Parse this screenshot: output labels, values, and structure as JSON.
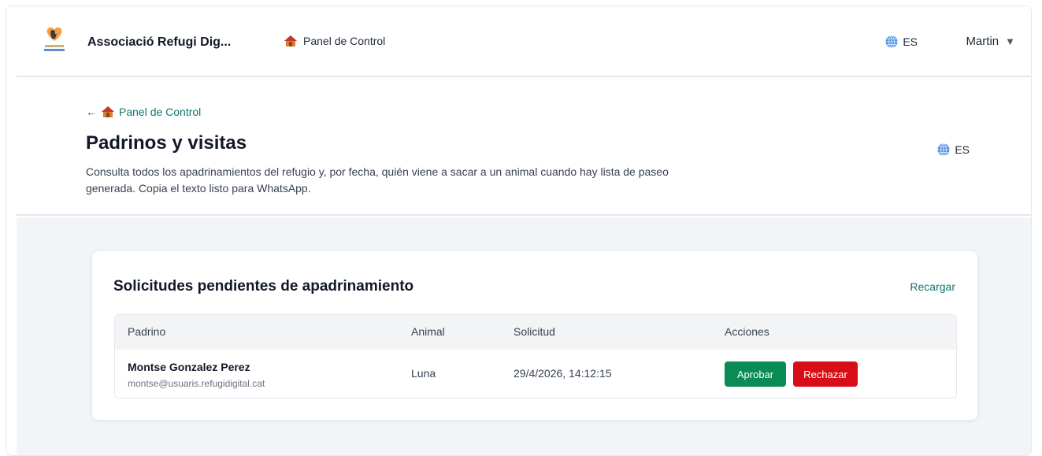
{
  "nav": {
    "brand": "Associació Refugi Dig...",
    "control_panel": "Panel de Control",
    "lang": "ES",
    "user": "Martin",
    "user_caret": "▼"
  },
  "header": {
    "back_arrow": "←",
    "back_label": "Panel de Control",
    "title": "Padrinos y visitas",
    "description": "Consulta todos los apadrinamientos del refugio y, por fecha, quién viene a sacar a un animal cuando hay lista de paseo generada. Copia el texto listo para WhatsApp.",
    "lang": "ES"
  },
  "card": {
    "title": "Solicitudes pendientes de apadrinamiento",
    "reload": "Recargar",
    "columns": [
      "Padrino",
      "Animal",
      "Solicitud",
      "Acciones"
    ],
    "rows": [
      {
        "name": "Montse Gonzalez Perez",
        "email": "montse@usuaris.refugidigital.cat",
        "animal": "Luna",
        "date": "29/4/2026, 14:12:15",
        "approve": "Aprobar",
        "reject": "Rechazar"
      }
    ]
  },
  "colors": {
    "accent": "#0f766e",
    "approve": "#0a8a55",
    "reject": "#d90d17",
    "content_bg": "#f1f5f7"
  },
  "icons": {
    "logo": "shelter-logo-icon",
    "house": "house-icon",
    "globe": "globe-icon"
  }
}
